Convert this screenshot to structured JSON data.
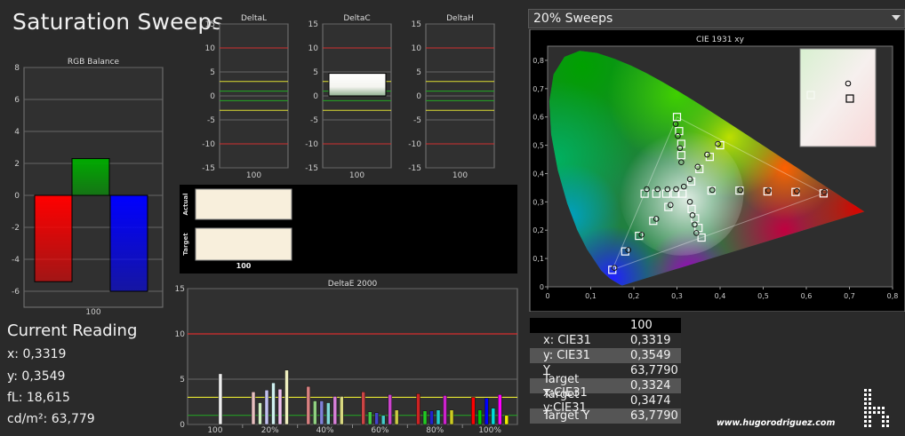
{
  "page": {
    "title": "Saturation Sweeps",
    "dropdown_value": "20% Sweeps",
    "credit": "www.hugorodriguez.com"
  },
  "current_reading": {
    "title": "Current Reading",
    "x": "x: 0,3319",
    "y": "y: 0,3549",
    "fl": "fL: 18,615",
    "cdm2": "cd/m²: 63,779"
  },
  "readings_table": {
    "header": "100",
    "rows": [
      {
        "label": "x: CIE31",
        "value": "0,3319"
      },
      {
        "label": "y: CIE31",
        "value": "0,3549"
      },
      {
        "label": "Y",
        "value": "63,7790"
      },
      {
        "label": "Target x:CIE31",
        "value": "0,3324"
      },
      {
        "label": "Target y:CIE31",
        "value": "0,3474"
      },
      {
        "label": "Target Y",
        "value": "63,7790"
      }
    ]
  },
  "swatch_panel": {
    "actual_label": "Actual",
    "target_label": "Target",
    "category": "100"
  },
  "chart_data": [
    {
      "type": "bar",
      "title": "RGB Balance",
      "categories": [
        "100"
      ],
      "ylim": [
        -7,
        8
      ],
      "yticks": [
        8,
        6,
        4,
        2,
        0,
        -2,
        -4,
        -6
      ],
      "series": [
        {
          "values": [
            -5.4
          ],
          "color": "#ff0000"
        },
        {
          "values": [
            2.3
          ],
          "color": "#00aa00"
        },
        {
          "values": [
            -6.0
          ],
          "color": "#0000ff"
        }
      ]
    },
    {
      "type": "bar",
      "title": "DeltaL",
      "categories": [
        "100"
      ],
      "ylim": [
        -15,
        15
      ],
      "yticks": [
        15,
        10,
        5,
        0,
        -5,
        -10,
        -15
      ],
      "values": [
        0
      ]
    },
    {
      "type": "bar",
      "title": "DeltaC",
      "categories": [
        "100"
      ],
      "ylim": [
        -15,
        15
      ],
      "yticks": [
        15,
        10,
        5,
        0,
        -5,
        -10,
        -15
      ],
      "values": [
        4.7
      ]
    },
    {
      "type": "bar",
      "title": "DeltaH",
      "categories": [
        "100"
      ],
      "ylim": [
        -15,
        15
      ],
      "yticks": [
        15,
        10,
        5,
        0,
        -5,
        -10,
        -15
      ],
      "values": [
        0
      ]
    },
    {
      "type": "bar",
      "title": "DeltaE 2000",
      "categories": [
        "100",
        "20%",
        "40%",
        "60%",
        "80%",
        "100%"
      ],
      "ylim": [
        0,
        15
      ],
      "yticks": [
        15,
        10,
        5,
        0
      ],
      "threshold_lines": [
        {
          "value": 10,
          "color": "#ff2b2b"
        },
        {
          "value": 3,
          "color": "#ffff33"
        },
        {
          "value": 1,
          "color": "#22aa22"
        }
      ],
      "groups": [
        [
          {
            "v": 5.6,
            "c": "#eeeeee"
          }
        ],
        [
          {
            "v": 3.6,
            "c": "#e8c0c0"
          },
          {
            "v": 2.4,
            "c": "#d0f0c0"
          },
          {
            "v": 3.8,
            "c": "#c0c0f0"
          },
          {
            "v": 4.6,
            "c": "#d0f0f0"
          },
          {
            "v": 3.9,
            "c": "#f0c0f0"
          },
          {
            "v": 6.0,
            "c": "#f0f0c0"
          }
        ],
        [
          {
            "v": 4.2,
            "c": "#d88080"
          },
          {
            "v": 2.6,
            "c": "#90d080"
          },
          {
            "v": 2.6,
            "c": "#8080d8"
          },
          {
            "v": 2.4,
            "c": "#80d8d8"
          },
          {
            "v": 3.1,
            "c": "#d880d8"
          },
          {
            "v": 3.1,
            "c": "#d8d880"
          }
        ],
        [
          {
            "v": 3.6,
            "c": "#cc4444"
          },
          {
            "v": 1.4,
            "c": "#44cc44"
          },
          {
            "v": 1.3,
            "c": "#4444cc"
          },
          {
            "v": 1.0,
            "c": "#44cccc"
          },
          {
            "v": 3.3,
            "c": "#cc44cc"
          },
          {
            "v": 1.6,
            "c": "#cccc44"
          }
        ],
        [
          {
            "v": 3.4,
            "c": "#cc2222"
          },
          {
            "v": 1.5,
            "c": "#22cc22"
          },
          {
            "v": 1.5,
            "c": "#2222cc"
          },
          {
            "v": 1.6,
            "c": "#22cccc"
          },
          {
            "v": 3.2,
            "c": "#cc22cc"
          },
          {
            "v": 1.6,
            "c": "#cccc22"
          }
        ],
        [
          {
            "v": 3.0,
            "c": "#ff0000"
          },
          {
            "v": 1.6,
            "c": "#00cc00"
          },
          {
            "v": 2.9,
            "c": "#0000ff"
          },
          {
            "v": 1.8,
            "c": "#00dddd"
          },
          {
            "v": 3.3,
            "c": "#ff00ff"
          },
          {
            "v": 1.0,
            "c": "#eeee00"
          }
        ]
      ]
    },
    {
      "type": "scatter",
      "title": "CIE 1931 xy",
      "xlim": [
        0,
        0.8
      ],
      "ylim": [
        0,
        0.85
      ],
      "xticks": [
        0,
        0.1,
        0.2,
        0.3,
        0.4,
        0.5,
        0.6,
        0.7,
        0.8
      ],
      "yticks": [
        0.8,
        0.7,
        0.6,
        0.5,
        0.4,
        0.3,
        0.2,
        0.1,
        0
      ],
      "gamut_triangle": [
        [
          0.64,
          0.33
        ],
        [
          0.3,
          0.6
        ],
        [
          0.15,
          0.06
        ]
      ],
      "targets": [
        [
          0.3,
          0.6
        ],
        [
          0.305,
          0.55
        ],
        [
          0.31,
          0.505
        ],
        [
          0.31,
          0.465
        ],
        [
          0.313,
          0.329
        ],
        [
          0.4,
          0.5
        ],
        [
          0.376,
          0.459
        ],
        [
          0.352,
          0.416
        ],
        [
          0.333,
          0.372
        ],
        [
          0.64,
          0.33
        ],
        [
          0.575,
          0.335
        ],
        [
          0.51,
          0.337
        ],
        [
          0.445,
          0.34
        ],
        [
          0.38,
          0.34
        ],
        [
          0.357,
          0.174
        ],
        [
          0.35,
          0.208
        ],
        [
          0.342,
          0.242
        ],
        [
          0.334,
          0.275
        ],
        [
          0.15,
          0.06
        ],
        [
          0.18,
          0.125
        ],
        [
          0.212,
          0.18
        ],
        [
          0.245,
          0.233
        ],
        [
          0.28,
          0.282
        ],
        [
          0.225,
          0.329
        ],
        [
          0.252,
          0.329
        ],
        [
          0.275,
          0.329
        ],
        [
          0.295,
          0.329
        ]
      ],
      "measured": [
        [
          0.297,
          0.575
        ],
        [
          0.302,
          0.533
        ],
        [
          0.307,
          0.49
        ],
        [
          0.31,
          0.44
        ],
        [
          0.316,
          0.354
        ],
        [
          0.395,
          0.505
        ],
        [
          0.37,
          0.467
        ],
        [
          0.348,
          0.424
        ],
        [
          0.33,
          0.38
        ],
        [
          0.642,
          0.335
        ],
        [
          0.578,
          0.338
        ],
        [
          0.512,
          0.34
        ],
        [
          0.447,
          0.342
        ],
        [
          0.382,
          0.342
        ],
        [
          0.345,
          0.19
        ],
        [
          0.341,
          0.22
        ],
        [
          0.336,
          0.253
        ],
        [
          0.33,
          0.3
        ],
        [
          0.155,
          0.067
        ],
        [
          0.187,
          0.13
        ],
        [
          0.218,
          0.184
        ],
        [
          0.252,
          0.24
        ],
        [
          0.285,
          0.289
        ],
        [
          0.23,
          0.345
        ],
        [
          0.255,
          0.345
        ],
        [
          0.278,
          0.345
        ],
        [
          0.298,
          0.345
        ]
      ],
      "inset": {
        "target": [
          0.3324,
          0.3474
        ],
        "measured": [
          0.3319,
          0.3549
        ]
      }
    }
  ]
}
